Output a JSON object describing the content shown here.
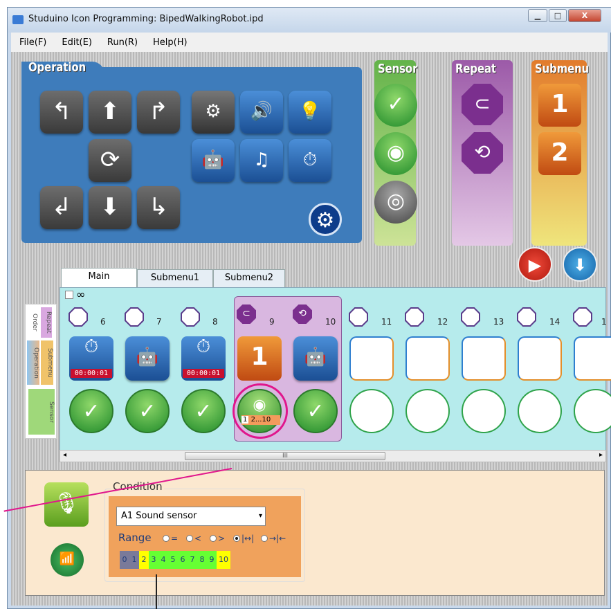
{
  "window": {
    "title": "Studuino Icon Programming: BipedWalkingRobot.ipd",
    "controls": [
      "▁",
      "□",
      "X"
    ]
  },
  "menu": [
    "File(F)",
    "Edit(E)",
    "Run(R)",
    "Help(H)"
  ],
  "palettes": {
    "operation": "Operation",
    "sensor": "Sensor",
    "repeat": "Repeat",
    "submenu": "Submenu",
    "submenu_tiles": [
      "1",
      "2"
    ]
  },
  "tabs": [
    "Main",
    "Submenu1",
    "Submenu2"
  ],
  "loop_symbol": "∞",
  "legend": {
    "order": "Order",
    "repeat": "Repeat",
    "operation": "Operation",
    "submenu": "Submenu",
    "sensor": "Sensor"
  },
  "columns": [
    "6",
    "7",
    "8",
    "9",
    "10",
    "11",
    "12",
    "13",
    "14",
    "1"
  ],
  "timer_label": "00:00:01",
  "submenu_block": "1",
  "sensor_badge": {
    "a": "1",
    "b": "2...10"
  },
  "scroll_label": "III",
  "condition": {
    "label": "Condition",
    "select_value": "A1 Sound sensor",
    "range_label": "Range",
    "range_options": [
      "=",
      "<",
      ">",
      "|↔|",
      "→|←"
    ],
    "selected_option": 3,
    "scale": [
      "0",
      "1",
      "2",
      "3",
      "4",
      "5",
      "6",
      "7",
      "8",
      "9",
      "10"
    ],
    "scale_colors": [
      "#7a7a9a",
      "#7a7a9a",
      "#ffff00",
      "#66ff33",
      "#66ff33",
      "#66ff33",
      "#66ff33",
      "#66ff33",
      "#66ff33",
      "#66ff33",
      "#ffff00"
    ]
  }
}
